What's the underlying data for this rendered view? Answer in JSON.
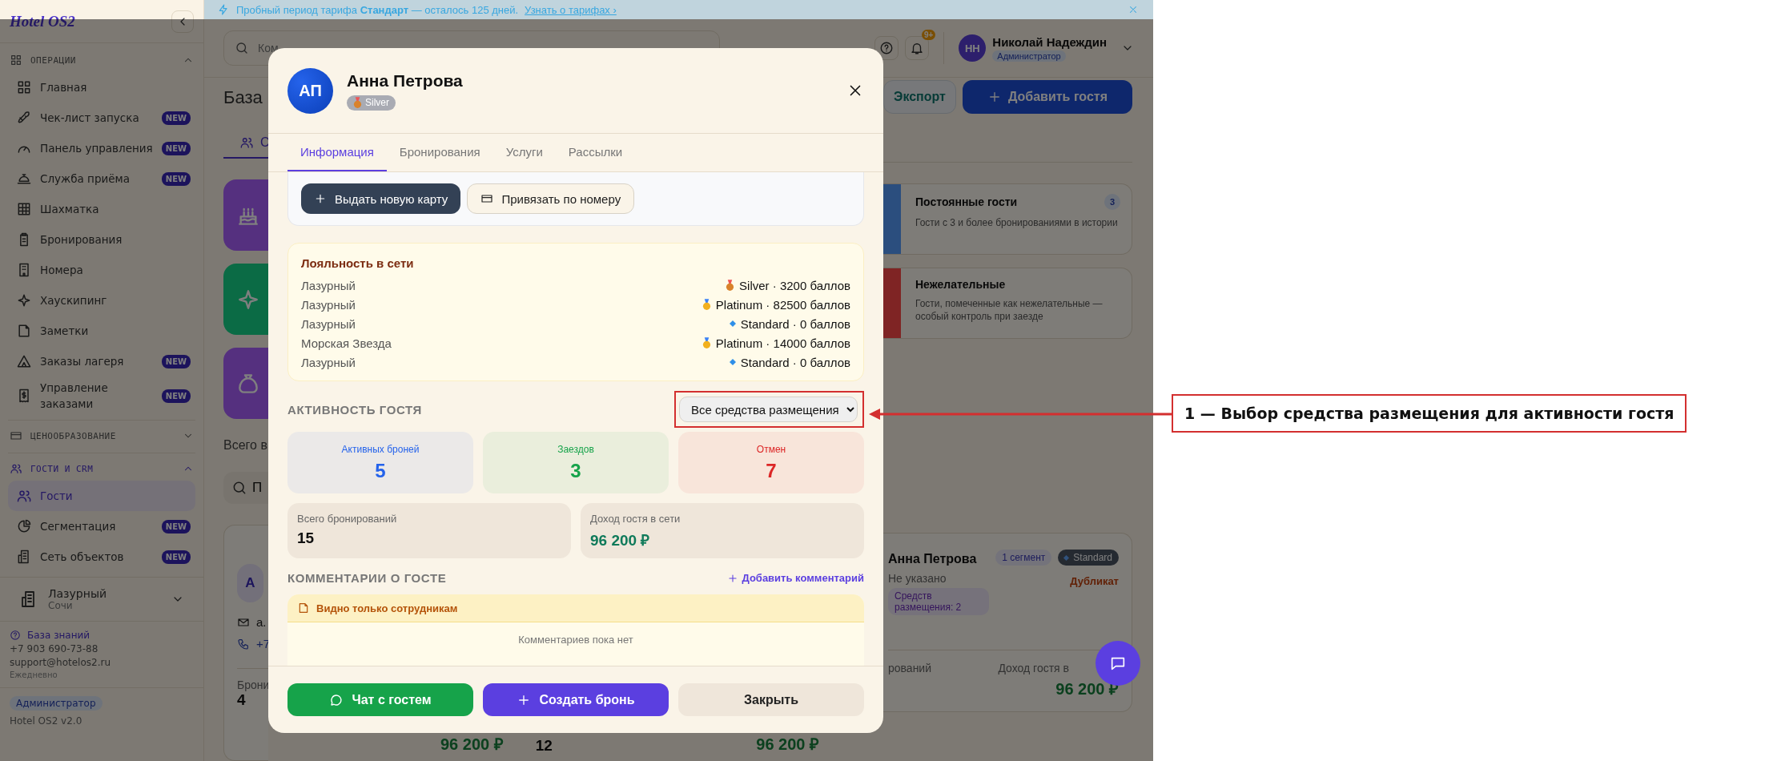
{
  "banner": {
    "text": "Пробный период тарифа **Стандарт** — осталось 125 дней.",
    "link": "Узнать о тарифах ›"
  },
  "sidebar": {
    "logo": "Hotel OS2",
    "sections": [
      {
        "title": "ОПЕРАЦИИ",
        "expanded": true,
        "selected": false,
        "items": [
          {
            "label": "Главная",
            "selected": false
          },
          {
            "label": "Чек-лист запуска",
            "badge": "NEW",
            "selected": false
          },
          {
            "label": "Панель управления",
            "badge": "NEW",
            "selected": false
          },
          {
            "label": "Служба приёма",
            "badge": "NEW",
            "selected": false
          },
          {
            "label": "Шахматка",
            "selected": false
          },
          {
            "label": "Бронирования",
            "selected": false
          },
          {
            "label": "Номера",
            "selected": false
          },
          {
            "label": "Хаускипинг",
            "selected": false
          },
          {
            "label": "Заметки",
            "selected": false
          },
          {
            "label": "Заказы лагеря",
            "badge": "NEW",
            "selected": false
          },
          {
            "label": "Управление заказами",
            "badge": "NEW",
            "selected": false
          }
        ]
      },
      {
        "title": "ЦЕНООБРАЗОВАНИЕ",
        "expanded": false,
        "selected": false
      },
      {
        "title": "ГОСТИ И CRM",
        "expanded": true,
        "selected": true,
        "items": [
          {
            "label": "Гости",
            "selected": true
          },
          {
            "label": "Сегментация",
            "badge": "NEW",
            "selected": false
          },
          {
            "label": "Сеть объектов",
            "badge": "NEW",
            "selected": false
          }
        ]
      }
    ],
    "property": {
      "name": "Лазурный",
      "city": "Сочи"
    },
    "support": {
      "link": "База знаний",
      "phone": "+7 903 690-73-88",
      "email": "support@hotelos2.ru",
      "hours": "Ежедневно"
    },
    "role": "Администратор",
    "version": "Hotel OS2 v2.0"
  },
  "topbar": {
    "search_placeholder": "Ком",
    "notifications": "9+",
    "user": {
      "initials": "НН",
      "name": "Николай Надеждин",
      "role": "Администратор"
    }
  },
  "page": {
    "heading": "База",
    "tab": "С",
    "export": "Экспорт",
    "add_guest": "Добавить гостя",
    "tiles": [
      {
        "color": "#55307f"
      },
      {
        "color": "#0b6b45"
      },
      {
        "color": "#55307f"
      }
    ],
    "segments": [
      {
        "title": "Постоянные гости",
        "description": "Гости с 3 и более бронированиями в истории",
        "count": "3",
        "color": "#2b4e7e"
      },
      {
        "title": "Нежелательные",
        "description": "Гости, помеченные как нежелательные — особый контроль при заезде",
        "color": "#8a2424"
      }
    ],
    "total": "Всего в",
    "search_placeholder": "П",
    "left_card": {
      "initial": "А",
      "email": "a.",
      "phone": "+7",
      "bookings_label": "Брони",
      "bookings": "4",
      "revenue": "96 200 ₽"
    },
    "middle_card": {
      "bookings": "12",
      "revenue": "96 200 ₽"
    },
    "right_card": {
      "name": "Анна Петрова",
      "segments": "1 сегмент",
      "tier": "Standard",
      "duplicate": "Дубликат",
      "gender": "Не указано",
      "properties": "Средств размещения: 2",
      "bookings_label": "рований",
      "revenue_label": "Доход гостя в",
      "revenue": "96 200 ₽"
    }
  },
  "guest_modal": {
    "initials": "АП",
    "name": "Анна Петрова",
    "tier": "Silver",
    "tabs": [
      {
        "label": "Информация",
        "selected": true
      },
      {
        "label": "Бронирования",
        "selected": false
      },
      {
        "label": "Услуги",
        "selected": false
      },
      {
        "label": "Рассылки",
        "selected": false
      }
    ],
    "card_actions": [
      {
        "label": "Выдать новую карту",
        "kind": "issue"
      },
      {
        "label": "Привязать по номеру",
        "kind": "link"
      }
    ],
    "loyalty": {
      "title": "Лояльность в сети",
      "rows": [
        {
          "property": "Лазурный",
          "kind": "bronze",
          "status": "Silver · 3200 баллов"
        },
        {
          "property": "Лазурный",
          "kind": "gold",
          "status": "Platinum · 82500 баллов"
        },
        {
          "property": "Лазурный",
          "kind": "diamond",
          "status": "Standard · 0 баллов"
        },
        {
          "property": "Морская Звезда",
          "kind": "gold",
          "status": "Platinum · 14000 баллов"
        },
        {
          "property": "Лазурный",
          "kind": "diamond",
          "status": "Standard · 0 баллов"
        }
      ]
    },
    "activity": {
      "title": "АКТИВНОСТЬ ГОСТЯ",
      "filter": "Все средства размещения",
      "stats": [
        {
          "label": "Активных броней",
          "value": "5",
          "color": "#2563eb"
        },
        {
          "label": "Заездов",
          "value": "3",
          "color": "#16a34a"
        },
        {
          "label": "Отмен",
          "value": "7",
          "color": "#dc2626"
        }
      ],
      "totals": [
        {
          "label": "Всего бронирований",
          "value": "15",
          "kind": "count"
        },
        {
          "label": "Доход гостя в сети",
          "value": "96 200 ₽",
          "kind": "money"
        }
      ]
    },
    "comments": {
      "title": "КОММЕНТАРИИ О ГОСТЕ",
      "add": "Добавить комментарий",
      "notice": "Видно только сотрудникам",
      "empty": "Комментариев пока нет"
    },
    "footer": [
      {
        "label": "Чат с гостем",
        "kind": "chat"
      },
      {
        "label": "Создать бронь",
        "kind": "create"
      },
      {
        "label": "Закрыть",
        "kind": "close"
      }
    ]
  },
  "annotation": {
    "label": "1 — Выбор средства размещения для активности гостя"
  }
}
